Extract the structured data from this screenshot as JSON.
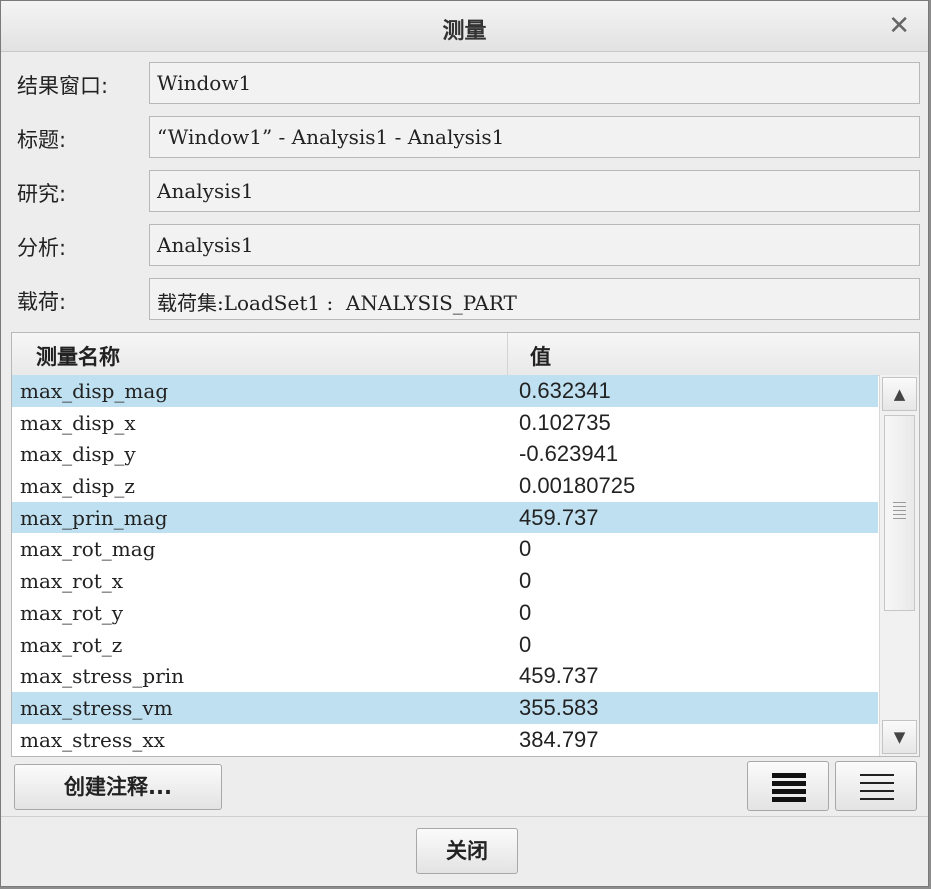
{
  "dialog": {
    "title": "测量",
    "close_glyph": "✕"
  },
  "form": {
    "result_window": {
      "label": "结果窗口:",
      "value": "Window1"
    },
    "title": {
      "label": "标题:",
      "value": "“Window1” - Analysis1 - Analysis1"
    },
    "study": {
      "label": "研究:",
      "value": "Analysis1"
    },
    "analysis": {
      "label": "分析:",
      "value": "Analysis1"
    },
    "load": {
      "label": "载荷:",
      "value": "载荷集:LoadSet1 :  ANALYSIS_PART"
    }
  },
  "table": {
    "headers": {
      "name": "测量名称",
      "value": "值"
    },
    "rows": [
      {
        "name": "max_disp_mag",
        "value": "0.632341",
        "selected": true
      },
      {
        "name": "max_disp_x",
        "value": "0.102735",
        "selected": false
      },
      {
        "name": "max_disp_y",
        "value": "-0.623941",
        "selected": false
      },
      {
        "name": "max_disp_z",
        "value": "0.00180725",
        "selected": false
      },
      {
        "name": "max_prin_mag",
        "value": "459.737",
        "selected": true
      },
      {
        "name": "max_rot_mag",
        "value": "0",
        "selected": false
      },
      {
        "name": "max_rot_x",
        "value": "0",
        "selected": false
      },
      {
        "name": "max_rot_y",
        "value": "0",
        "selected": false
      },
      {
        "name": "max_rot_z",
        "value": "0",
        "selected": false
      },
      {
        "name": "max_stress_prin",
        "value": "459.737",
        "selected": false
      },
      {
        "name": "max_stress_vm",
        "value": "355.583",
        "selected": true
      },
      {
        "name": "max_stress_xx",
        "value": "384.797",
        "selected": false
      }
    ],
    "scroll_up_glyph": "▲",
    "scroll_down_glyph": "▼"
  },
  "buttons": {
    "create_note": "创建注释...",
    "close": "关闭"
  },
  "icons": {
    "view_thick_lines": "view-thick-lines-icon",
    "view_thin_lines": "view-thin-lines-icon"
  },
  "colors": {
    "selection": "#bfe0f1",
    "dialog_bg": "#ededed"
  }
}
